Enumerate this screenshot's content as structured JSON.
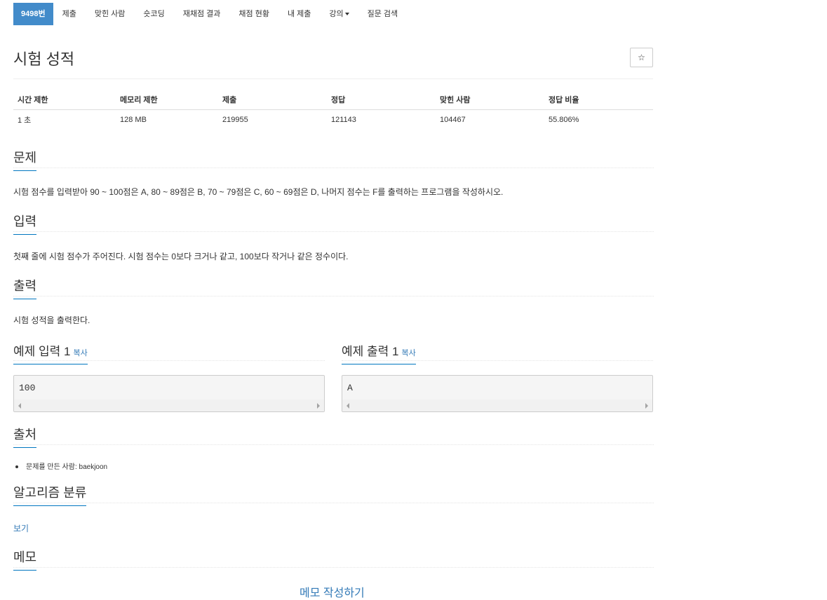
{
  "nav": {
    "problem_no": "9498번",
    "submit": "제출",
    "solved_users": "맞힌 사람",
    "short_coding": "숏코딩",
    "rejudge": "재채점 결과",
    "judge_status": "채점 현황",
    "my_submissions": "내 제출",
    "lecture": "강의",
    "qna_search": "질문 검색"
  },
  "title": "시험 성적",
  "star_icon": "☆",
  "info": {
    "headers": [
      "시간 제한",
      "메모리 제한",
      "제출",
      "정답",
      "맞힌 사람",
      "정답 비율"
    ],
    "values": [
      "1 초",
      "128 MB",
      "219955",
      "121143",
      "104467",
      "55.806%"
    ]
  },
  "sections": {
    "problem_h": "문제",
    "problem_text": "시험 점수를 입력받아 90 ~ 100점은 A, 80 ~ 89점은 B, 70 ~ 79점은 C, 60 ~ 69점은 D, 나머지 점수는 F를 출력하는 프로그램을 작성하시오.",
    "input_h": "입력",
    "input_text": "첫째 줄에 시험 점수가 주어진다. 시험 점수는 0보다 크거나 같고, 100보다 작거나 같은 정수이다.",
    "output_h": "출력",
    "output_text": "시험 성적을 출력한다.",
    "sample_in_h": "예제 입력 1",
    "sample_out_h": "예제 출력 1",
    "copy": "복사",
    "sample_in": "100",
    "sample_out": "A",
    "source_h": "출처",
    "source_label": "문제를 만든 사람: ",
    "source_user": "baekjoon",
    "algo_h": "알고리즘 분류",
    "algo_view": "보기",
    "memo_h": "메모",
    "memo_write": "메모 작성하기"
  }
}
